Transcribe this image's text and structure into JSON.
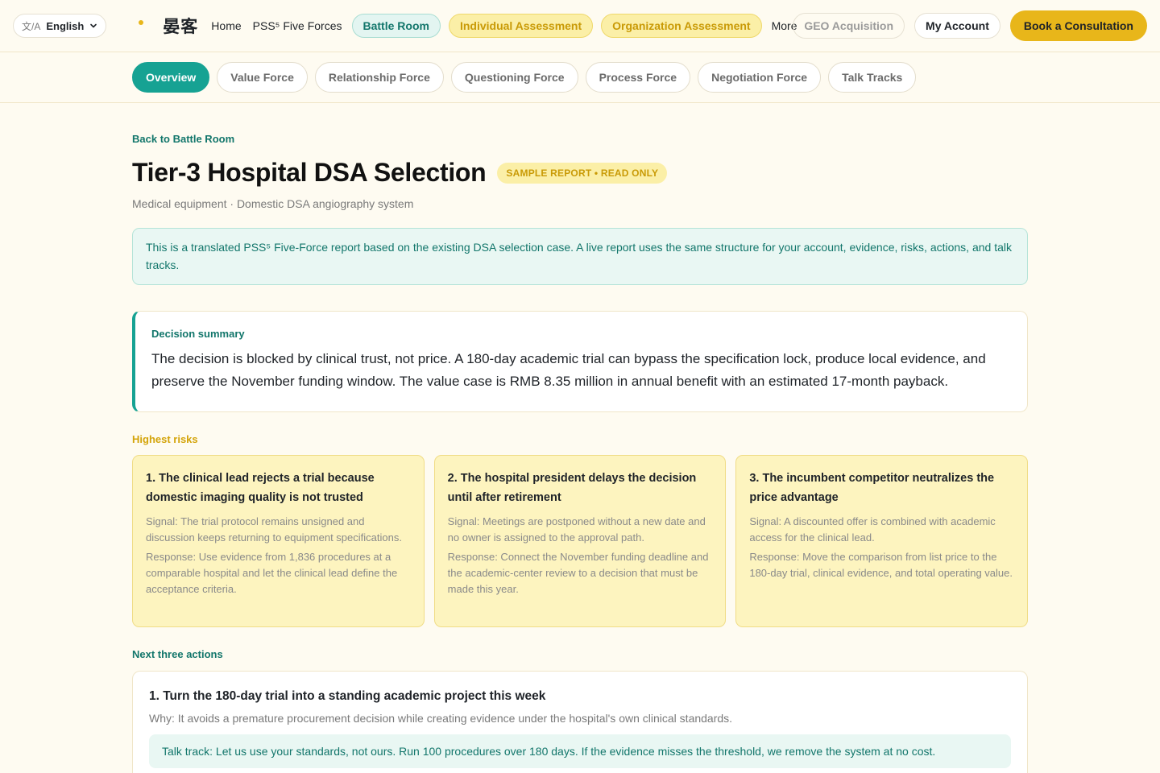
{
  "nav": {
    "lang_icon": "文/A",
    "lang_label": "English",
    "brand": "晏客",
    "links": [
      "Home",
      "PSS⁵ Five Forces"
    ],
    "battle_room": "Battle Room",
    "individual": "Individual Assessment",
    "organization": "Organization Assessment",
    "more": "More",
    "geo": "GEO Acquisition",
    "account": "My Account",
    "consult": "Book a Consultation"
  },
  "tabs": [
    "Overview",
    "Value Force",
    "Relationship Force",
    "Questioning Force",
    "Process Force",
    "Negotiation Force",
    "Talk Tracks"
  ],
  "page": {
    "back": "Back to Battle Room",
    "title": "Tier-3 Hospital DSA Selection",
    "badge": "SAMPLE REPORT • READ ONLY",
    "subtitle": "Medical equipment · Domestic DSA angiography system",
    "notice": "This is a translated PSS⁵ Five-Force report based on the existing DSA selection case. A live report uses the same structure for your account, evidence, risks, actions, and talk tracks."
  },
  "summary": {
    "label": "Decision summary",
    "text": "The decision is blocked by clinical trust, not price. A 180-day academic trial can bypass the specification lock, produce local evidence, and preserve the November funding window. The value case is RMB 8.35 million in annual benefit with an estimated 17-month payback."
  },
  "risks": {
    "label": "Highest risks",
    "items": [
      {
        "title": "1. The clinical lead rejects a trial because domestic imaging quality is not trusted",
        "signal": "Signal: The trial protocol remains unsigned and discussion keeps returning to equipment specifications.",
        "response": "Response: Use evidence from 1,836 procedures at a comparable hospital and let the clinical lead define the acceptance criteria."
      },
      {
        "title": "2. The hospital president delays the decision until after retirement",
        "signal": "Signal: Meetings are postponed without a new date and no owner is assigned to the approval path.",
        "response": "Response: Connect the November funding deadline and the academic-center review to a decision that must be made this year."
      },
      {
        "title": "3. The incumbent competitor neutralizes the price advantage",
        "signal": "Signal: A discounted offer is combined with academic access for the clinical lead.",
        "response": "Response: Move the comparison from list price to the 180-day trial, clinical evidence, and total operating value."
      }
    ]
  },
  "actions": {
    "label": "Next three actions",
    "first": {
      "title": "1. Turn the 180-day trial into a standing academic project this week",
      "why": "Why: It avoids a premature procurement decision while creating evidence under the hospital's own clinical standards.",
      "talk": "Talk track: Let us use your standards, not ours. Run 100 procedures over 180 days. If the evidence misses the threshold, we remove the system at no cost."
    }
  }
}
